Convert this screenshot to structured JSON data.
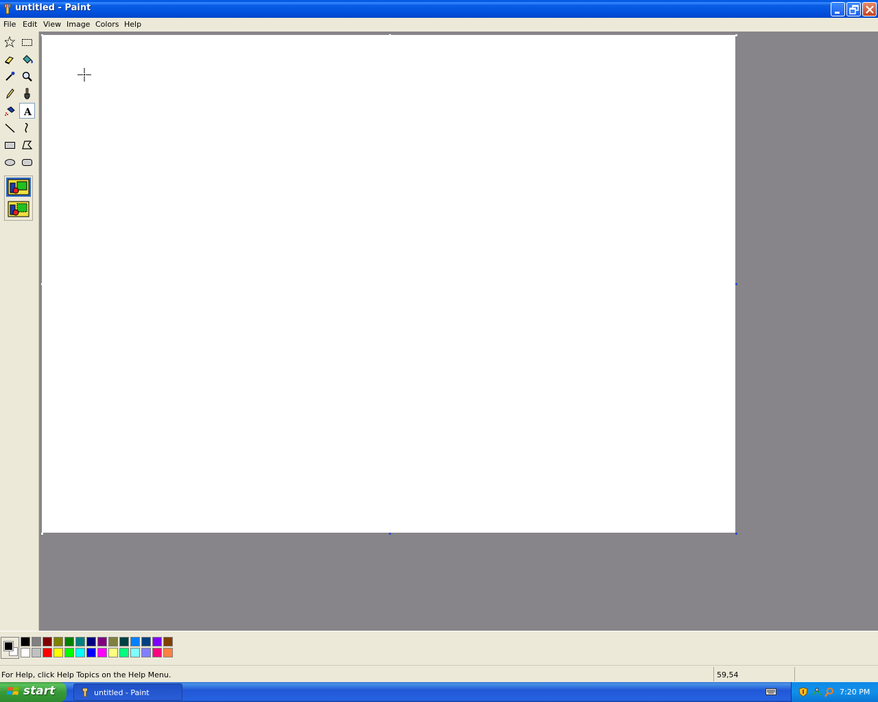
{
  "window": {
    "title": "untitled - Paint",
    "buttons": [
      "minimize",
      "restore",
      "close"
    ]
  },
  "menubar": {
    "items": [
      "File",
      "Edit",
      "View",
      "Image",
      "Colors",
      "Help"
    ]
  },
  "toolbox": {
    "tools": [
      {
        "name": "free-form-select",
        "icon": "star-select-icon"
      },
      {
        "name": "select",
        "icon": "rect-select-icon"
      },
      {
        "name": "eraser",
        "icon": "eraser-icon"
      },
      {
        "name": "fill-with-color",
        "icon": "paint-bucket-icon"
      },
      {
        "name": "pick-color",
        "icon": "eyedropper-icon"
      },
      {
        "name": "magnifier",
        "icon": "magnifier-icon"
      },
      {
        "name": "pencil",
        "icon": "pencil-icon"
      },
      {
        "name": "brush",
        "icon": "brush-icon"
      },
      {
        "name": "airbrush",
        "icon": "airbrush-icon"
      },
      {
        "name": "text",
        "icon": "text-icon",
        "active": true
      },
      {
        "name": "line",
        "icon": "line-icon"
      },
      {
        "name": "curve",
        "icon": "curve-icon"
      },
      {
        "name": "rectangle",
        "icon": "rectangle-icon"
      },
      {
        "name": "polygon",
        "icon": "polygon-icon"
      },
      {
        "name": "ellipse",
        "icon": "ellipse-icon"
      },
      {
        "name": "rounded-rectangle",
        "icon": "rounded-rectangle-icon"
      }
    ],
    "text_background_options": [
      "opaque",
      "transparent"
    ],
    "selected_option": "opaque"
  },
  "palette": {
    "foreground": "#000000",
    "background": "#ffffff",
    "colors": [
      "#000000",
      "#808080",
      "#800000",
      "#808000",
      "#008000",
      "#008080",
      "#000080",
      "#800080",
      "#808040",
      "#004040",
      "#0080ff",
      "#004080",
      "#8000ff",
      "#804000",
      "#ffffff",
      "#c0c0c0",
      "#ff0000",
      "#ffff00",
      "#00ff00",
      "#00ffff",
      "#0000ff",
      "#ff00ff",
      "#ffff80",
      "#00ff80",
      "#80ffff",
      "#8080ff",
      "#ff0080",
      "#ff8040"
    ]
  },
  "status": {
    "help": "For Help, click Help Topics on the Help Menu.",
    "coords": "59,54"
  },
  "taskbar": {
    "start_label": "start",
    "task_label": "untitled - Paint",
    "clock": "7:20 PM"
  }
}
